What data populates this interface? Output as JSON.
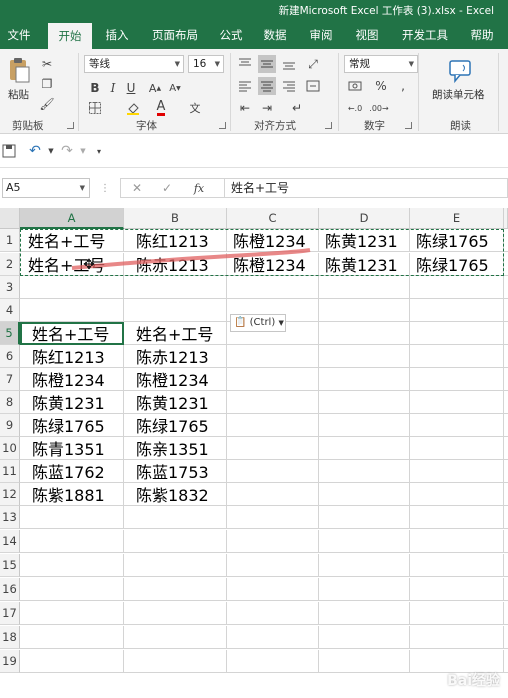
{
  "window": {
    "title": "新建Microsoft Excel 工作表 (3).xlsx  -  Excel"
  },
  "ribbon_tabs": [
    "文件",
    "开始",
    "插入",
    "页面布局",
    "公式",
    "数据",
    "审阅",
    "视图",
    "开发工具",
    "帮助"
  ],
  "ribbon": {
    "paste_label": "粘贴",
    "groups": {
      "clipboard": "剪贴板",
      "font": "字体",
      "alignment": "对齐方式",
      "number": "数字",
      "read": "朗读"
    },
    "font_name": "等线",
    "font_size": "16",
    "number_format": "常规",
    "read_cells_label": "朗读单元格",
    "bold": "B",
    "italic": "I",
    "underline": "U"
  },
  "formula_bar": {
    "name_box": "A5",
    "fx": "fx",
    "formula": "姓名+工号"
  },
  "grid": {
    "columns": [
      "A",
      "B",
      "C",
      "D",
      "E"
    ],
    "rows": [
      "1",
      "2",
      "3",
      "4",
      "5",
      "6",
      "7",
      "8",
      "9",
      "10",
      "11",
      "12",
      "13",
      "14",
      "15",
      "16",
      "17",
      "18",
      "19"
    ],
    "cells": {
      "r1": [
        "姓名+工号",
        "陈红1213",
        "陈橙1234",
        "陈黄1231",
        "陈绿1765"
      ],
      "r2": [
        "姓名+工号",
        "陈赤1213",
        "陈橙1234",
        "陈黄1231",
        "陈绿1765"
      ],
      "r5": [
        "姓名+工号",
        "姓名+工号"
      ],
      "r6": [
        "陈红1213",
        "陈赤1213"
      ],
      "r7": [
        "陈橙1234",
        "陈橙1234"
      ],
      "r8": [
        "陈黄1231",
        "陈黄1231"
      ],
      "r9": [
        "陈绿1765",
        "陈绿1765"
      ],
      "r10": [
        "陈青1351",
        "陈亲1351"
      ],
      "r11": [
        "陈蓝1762",
        "陈蓝1753"
      ],
      "r12": [
        "陈紫1881",
        "陈紫1832"
      ]
    }
  },
  "paste_options": "(Ctrl)",
  "watermark": "Bai经验"
}
